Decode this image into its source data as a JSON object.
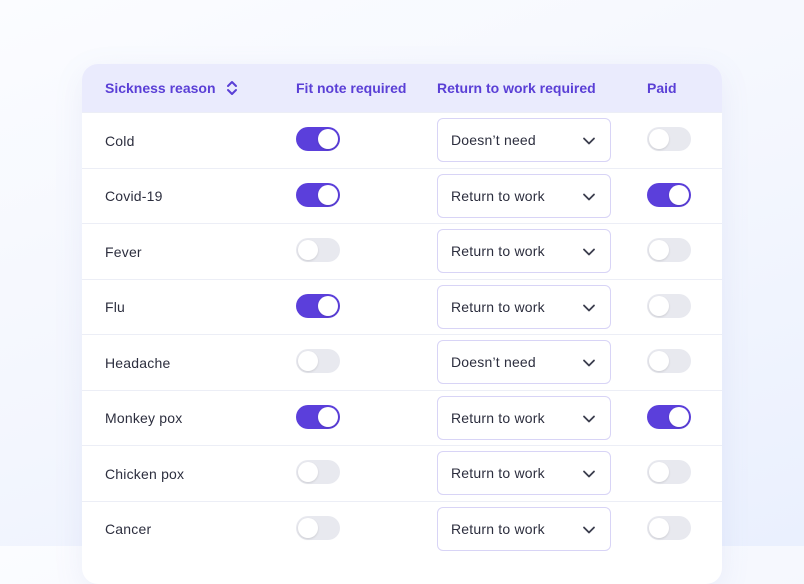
{
  "table": {
    "headers": {
      "reason": "Sickness reason",
      "fit_note": "Fit note required",
      "return_to_work": "Return to work required",
      "paid": "Paid"
    },
    "rows": [
      {
        "reason": "Cold",
        "fit_note": true,
        "return_to_work": "Doesn’t need",
        "paid": false
      },
      {
        "reason": "Covid-19",
        "fit_note": true,
        "return_to_work": "Return to work",
        "paid": true
      },
      {
        "reason": "Fever",
        "fit_note": false,
        "return_to_work": "Return to work",
        "paid": false
      },
      {
        "reason": "Flu",
        "fit_note": true,
        "return_to_work": "Return to work",
        "paid": false
      },
      {
        "reason": "Headache",
        "fit_note": false,
        "return_to_work": "Doesn’t need",
        "paid": false
      },
      {
        "reason": "Monkey pox",
        "fit_note": true,
        "return_to_work": "Return to work",
        "paid": true
      },
      {
        "reason": "Chicken pox",
        "fit_note": false,
        "return_to_work": "Return to work",
        "paid": false
      },
      {
        "reason": "Cancer",
        "fit_note": false,
        "return_to_work": "Return to work",
        "paid": false
      }
    ]
  },
  "icons": {
    "sort": "sort-up-down-icon",
    "dropdown": "chevron-down-icon"
  },
  "colors": {
    "accent": "#5b3fdb",
    "header_bg": "#eaebfd",
    "header_text": "#5a3fd6",
    "toggle_off": "#e8e9ef"
  }
}
